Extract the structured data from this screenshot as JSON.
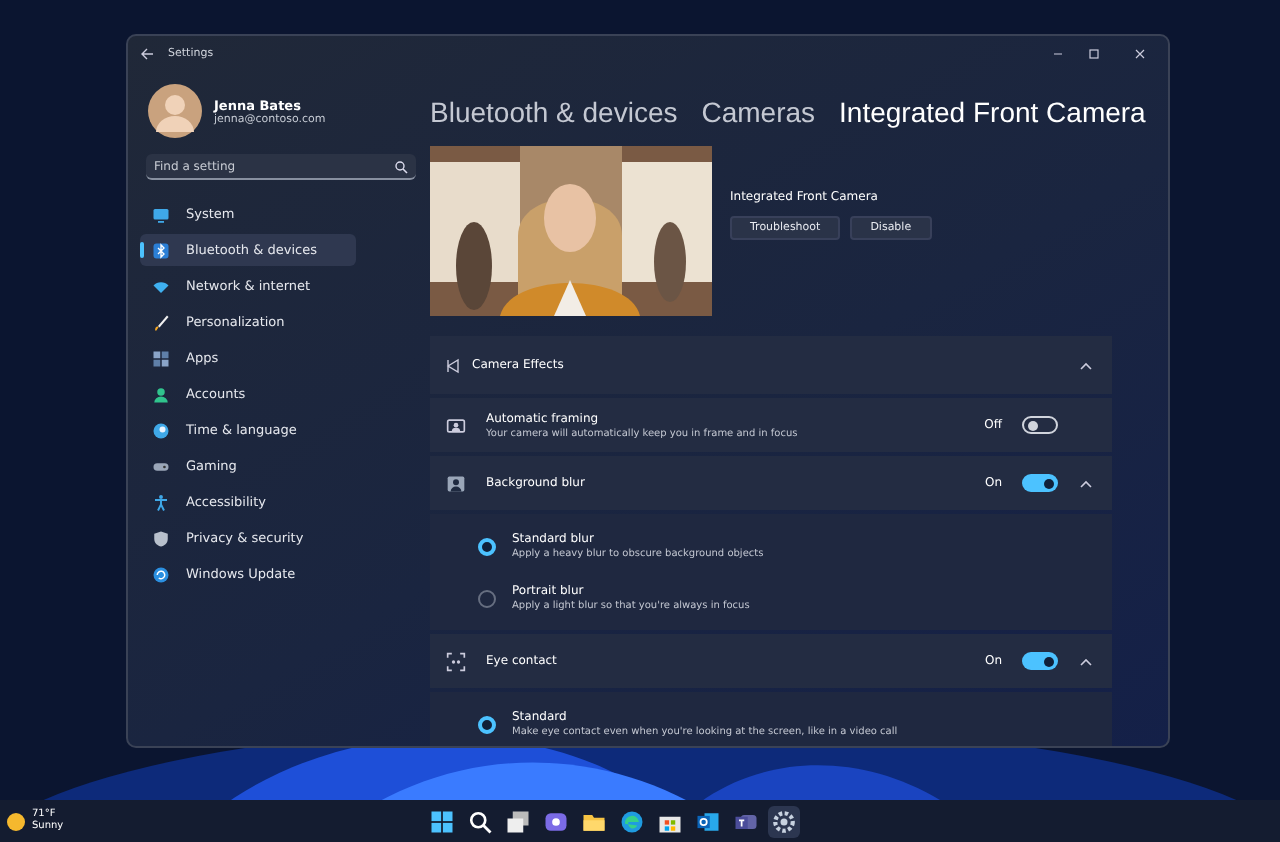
{
  "window": {
    "title": "Settings"
  },
  "account": {
    "name": "Jenna Bates",
    "email": "jenna@contoso.com"
  },
  "search": {
    "placeholder": "Find a setting"
  },
  "nav": [
    {
      "label": "System",
      "kind": "system",
      "selected": false
    },
    {
      "label": "Bluetooth & devices",
      "kind": "bluetooth",
      "selected": true
    },
    {
      "label": "Network & internet",
      "kind": "network",
      "selected": false
    },
    {
      "label": "Personalization",
      "kind": "personalization",
      "selected": false
    },
    {
      "label": "Apps",
      "kind": "apps",
      "selected": false
    },
    {
      "label": "Accounts",
      "kind": "accounts",
      "selected": false
    },
    {
      "label": "Time & language",
      "kind": "time",
      "selected": false
    },
    {
      "label": "Gaming",
      "kind": "gaming",
      "selected": false
    },
    {
      "label": "Accessibility",
      "kind": "accessibility",
      "selected": false
    },
    {
      "label": "Privacy & security",
      "kind": "privacy",
      "selected": false
    },
    {
      "label": "Windows Update",
      "kind": "update",
      "selected": false
    }
  ],
  "breadcrumb": [
    "Bluetooth & devices",
    "Cameras",
    "Integrated Front Camera"
  ],
  "camera": {
    "name": "Integrated Front Camera",
    "buttons": [
      "Troubleshoot",
      "Disable"
    ]
  },
  "effects": {
    "title": "Camera Effects",
    "expanded": true,
    "settings": [
      {
        "kind": "framing",
        "title": "Automatic framing",
        "description": "Your camera will automatically keep you in frame and in focus",
        "state": "Off",
        "on": false
      },
      {
        "kind": "blur",
        "title": "Background blur",
        "state": "On",
        "on": true,
        "expanded": true,
        "options": [
          {
            "label": "Standard blur",
            "description": "Apply a heavy blur to obscure background objects",
            "selected": true
          },
          {
            "label": "Portrait blur",
            "description": "Apply a light blur so that you're always in focus",
            "selected": false
          }
        ]
      },
      {
        "kind": "eye",
        "title": "Eye contact",
        "state": "On",
        "on": true,
        "expanded": true,
        "options": [
          {
            "label": "Standard",
            "description": "Make eye contact even when you're looking at the screen, like in a video call",
            "selected": true
          }
        ]
      }
    ]
  },
  "taskbar": {
    "weather": {
      "temperature": "71°F",
      "condition": "Sunny"
    },
    "apps": [
      {
        "kind": "start",
        "selected": false
      },
      {
        "kind": "search",
        "selected": false
      },
      {
        "kind": "taskview",
        "selected": false
      },
      {
        "kind": "chat",
        "selected": false
      },
      {
        "kind": "explorer",
        "selected": false
      },
      {
        "kind": "edge",
        "selected": false
      },
      {
        "kind": "store",
        "selected": false
      },
      {
        "kind": "outlook",
        "selected": false
      },
      {
        "kind": "teams",
        "selected": false
      },
      {
        "kind": "settings",
        "selected": true
      }
    ]
  }
}
